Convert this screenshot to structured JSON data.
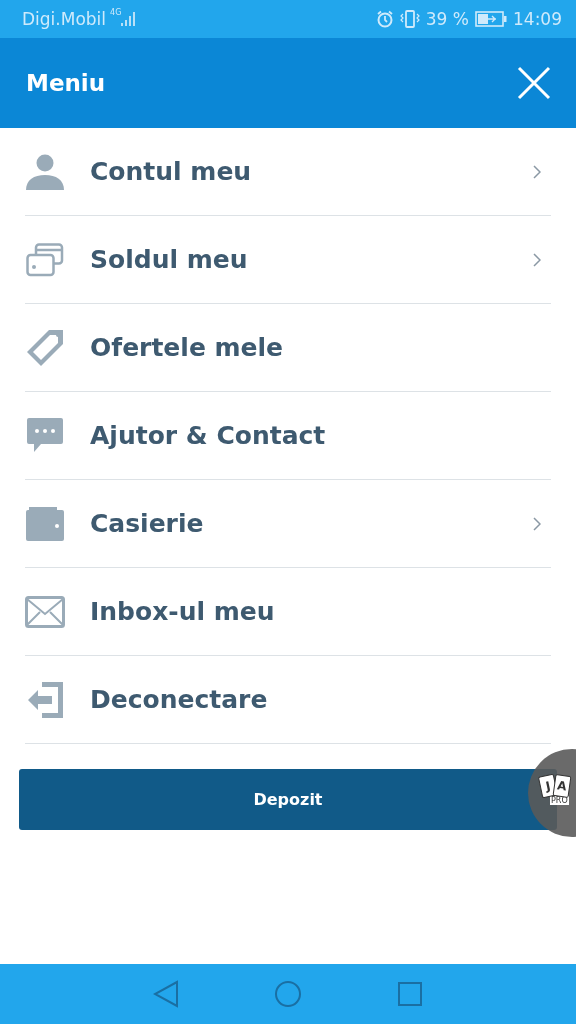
{
  "status_bar": {
    "carrier": "Digi.Mobil",
    "network": "4G",
    "battery_percent": "39 %",
    "time": "14:09"
  },
  "header": {
    "title": "Meniu"
  },
  "menu_items": [
    {
      "label": "Contul meu",
      "kind": "account",
      "submenu": true
    },
    {
      "label": "Soldul meu",
      "kind": "balance",
      "submenu": true
    },
    {
      "label": "Ofertele mele",
      "kind": "offers",
      "submenu": false
    },
    {
      "label": "Ajutor & Contact",
      "kind": "help",
      "submenu": false
    },
    {
      "label": "Casierie",
      "kind": "cashier",
      "submenu": true
    },
    {
      "label": "Inbox-ul meu",
      "kind": "inbox",
      "submenu": false
    },
    {
      "label": "Deconectare",
      "kind": "logout",
      "submenu": false
    }
  ],
  "deposit_button": {
    "label": "Depozit"
  },
  "floating_badge": {
    "cards": [
      "J",
      "A"
    ],
    "label": "PRO"
  }
}
